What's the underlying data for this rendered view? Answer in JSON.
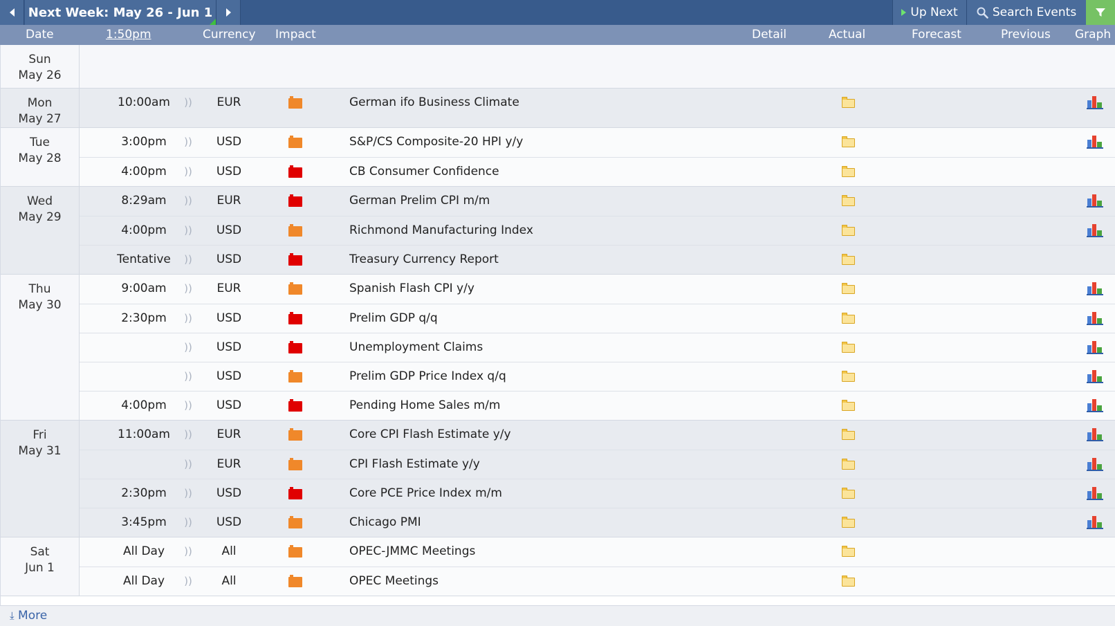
{
  "toolbar": {
    "week_title": "Next Week: May 26 - Jun 1",
    "up_next_label": "Up Next",
    "search_label": "Search Events"
  },
  "columns": {
    "date": "Date",
    "time": "1:50pm",
    "currency": "Currency",
    "impact": "Impact",
    "detail": "Detail",
    "actual": "Actual",
    "forecast": "Forecast",
    "previous": "Previous",
    "graph": "Graph"
  },
  "colors": {
    "topbar": "#385b8c",
    "header": "#7d92b6",
    "impact_medium": "#f0882a",
    "impact_high": "#e00000",
    "filter": "#76c264"
  },
  "days": [
    {
      "dow": "Sun",
      "date": "May 26",
      "shade": "white",
      "events": []
    },
    {
      "dow": "Mon",
      "date": "May 27",
      "shade": "shade",
      "events": [
        {
          "time": "10:00am",
          "currency": "EUR",
          "impact": "orange",
          "title": "German ifo Business Climate",
          "graph": true
        }
      ]
    },
    {
      "dow": "Tue",
      "date": "May 28",
      "shade": "white",
      "events": [
        {
          "time": "3:00pm",
          "currency": "USD",
          "impact": "orange",
          "title": "S&P/CS Composite-20 HPI y/y",
          "graph": true
        },
        {
          "time": "4:00pm",
          "currency": "USD",
          "impact": "red",
          "title": "CB Consumer Confidence",
          "graph": false
        }
      ]
    },
    {
      "dow": "Wed",
      "date": "May 29",
      "shade": "shade",
      "events": [
        {
          "time": "8:29am",
          "currency": "EUR",
          "impact": "red",
          "title": "German Prelim CPI m/m",
          "graph": true
        },
        {
          "time": "4:00pm",
          "currency": "USD",
          "impact": "orange",
          "title": "Richmond Manufacturing Index",
          "graph": true
        },
        {
          "time": "Tentative",
          "currency": "USD",
          "impact": "red",
          "title": "Treasury Currency Report",
          "graph": false
        }
      ]
    },
    {
      "dow": "Thu",
      "date": "May 30",
      "shade": "white",
      "events": [
        {
          "time": "9:00am",
          "currency": "EUR",
          "impact": "orange",
          "title": "Spanish Flash CPI y/y",
          "graph": true
        },
        {
          "time": "2:30pm",
          "currency": "USD",
          "impact": "red",
          "title": "Prelim GDP q/q",
          "graph": true
        },
        {
          "time": "",
          "currency": "USD",
          "impact": "red",
          "title": "Unemployment Claims",
          "graph": true
        },
        {
          "time": "",
          "currency": "USD",
          "impact": "orange",
          "title": "Prelim GDP Price Index q/q",
          "graph": true
        },
        {
          "time": "4:00pm",
          "currency": "USD",
          "impact": "red",
          "title": "Pending Home Sales m/m",
          "graph": true
        }
      ]
    },
    {
      "dow": "Fri",
      "date": "May 31",
      "shade": "shade",
      "events": [
        {
          "time": "11:00am",
          "currency": "EUR",
          "impact": "orange",
          "title": "Core CPI Flash Estimate y/y",
          "graph": true
        },
        {
          "time": "",
          "currency": "EUR",
          "impact": "orange",
          "title": "CPI Flash Estimate y/y",
          "graph": true
        },
        {
          "time": "2:30pm",
          "currency": "USD",
          "impact": "red",
          "title": "Core PCE Price Index m/m",
          "graph": true
        },
        {
          "time": "3:45pm",
          "currency": "USD",
          "impact": "orange",
          "title": "Chicago PMI",
          "graph": true
        }
      ]
    },
    {
      "dow": "Sat",
      "date": "Jun 1",
      "shade": "white",
      "events": [
        {
          "time": "All Day",
          "currency": "All",
          "impact": "orange",
          "title": "OPEC-JMMC Meetings",
          "graph": false
        },
        {
          "time": "All Day",
          "currency": "All",
          "impact": "orange",
          "title": "OPEC Meetings",
          "graph": false
        }
      ]
    }
  ],
  "footer": {
    "more_label": "More"
  }
}
